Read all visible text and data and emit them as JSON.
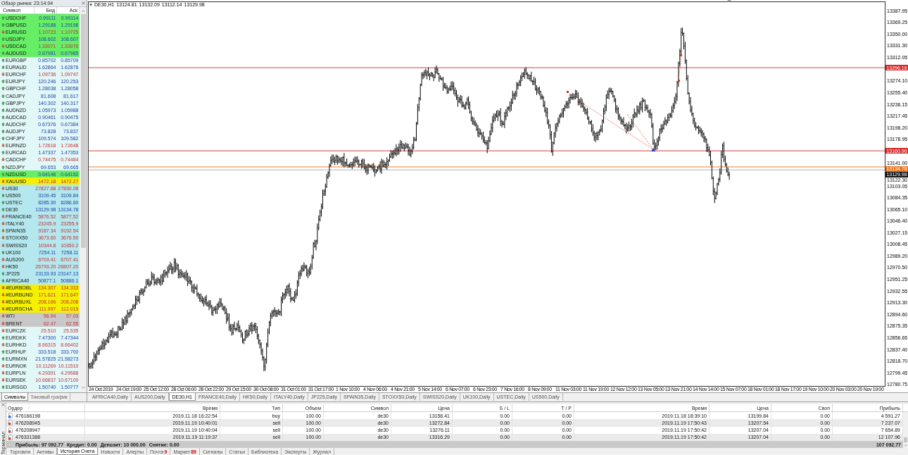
{
  "market_watch": {
    "title": "Обзор рынка: 23:14:04",
    "columns": [
      "Символ",
      "Бид",
      "Аск"
    ],
    "rows": [
      {
        "symbol": "USDCHF",
        "bid": "0.99111",
        "ask": "0.99114",
        "rising": true,
        "color": "#66ee66"
      },
      {
        "symbol": "GBPUSD",
        "bid": "1.29188",
        "ask": "1.29198",
        "rising": true,
        "color": "#66ee66"
      },
      {
        "symbol": "EURUSD",
        "bid": "1.10723",
        "ask": "1.10725",
        "rising": false,
        "color": "#66ee66"
      },
      {
        "symbol": "USDJPY",
        "bid": "108.602",
        "ask": "108.607",
        "rising": true,
        "color": "#66ee66"
      },
      {
        "symbol": "USDCAD",
        "bid": "1.33071",
        "ask": "1.33076",
        "rising": false,
        "color": "#66ee66"
      },
      {
        "symbol": "AUDUSD",
        "bid": "0.67981",
        "ask": "0.67985",
        "rising": true,
        "color": "#66ee66"
      },
      {
        "symbol": "EURGBP",
        "bid": "0.85702",
        "ask": "0.85709",
        "rising": true,
        "color": "#e2f7f7"
      },
      {
        "symbol": "EURAUD",
        "bid": "1.62864",
        "ask": "1.62876",
        "rising": true,
        "color": "#e2f7f7"
      },
      {
        "symbol": "EURCHF",
        "bid": "1.09736",
        "ask": "1.09747",
        "rising": false,
        "color": "#e2f7f7"
      },
      {
        "symbol": "EURJPY",
        "bid": "120.246",
        "ask": "120.253",
        "rising": true,
        "color": "#e2f7f7"
      },
      {
        "symbol": "GBPCHF",
        "bid": "1.28038",
        "ask": "1.28058",
        "rising": true,
        "color": "#e2f7f7"
      },
      {
        "symbol": "CADJPY",
        "bid": "81.608",
        "ask": "81.617",
        "rising": true,
        "color": "#e2f7f7"
      },
      {
        "symbol": "GBPJPY",
        "bid": "140.302",
        "ask": "140.317",
        "rising": true,
        "color": "#e2f7f7"
      },
      {
        "symbol": "AUDNZD",
        "bid": "1.05973",
        "ask": "1.05988",
        "rising": true,
        "color": "#e2f7f7"
      },
      {
        "symbol": "AUDCAD",
        "bid": "0.90461",
        "ask": "0.90475",
        "rising": true,
        "color": "#e2f7f7"
      },
      {
        "symbol": "AUDCHF",
        "bid": "0.67376",
        "ask": "0.67384",
        "rising": true,
        "color": "#e2f7f7"
      },
      {
        "symbol": "AUDJPY",
        "bid": "73.828",
        "ask": "73.837",
        "rising": true,
        "color": "#e2f7f7"
      },
      {
        "symbol": "CHFJPY",
        "bid": "109.574",
        "ask": "109.582",
        "rising": true,
        "color": "#e2f7f7"
      },
      {
        "symbol": "EURNZD",
        "bid": "1.72618",
        "ask": "1.72648",
        "rising": false,
        "color": "#e2f7f7"
      },
      {
        "symbol": "EURCAD",
        "bid": "1.47337",
        "ask": "1.47353",
        "rising": true,
        "color": "#e2f7f7"
      },
      {
        "symbol": "CADCHF",
        "bid": "0.74475",
        "ask": "0.74484",
        "rising": false,
        "color": "#e2f7f7"
      },
      {
        "symbol": "NZDJPY",
        "bid": "69.653",
        "ask": "69.665",
        "rising": true,
        "color": "#e2f7f7"
      },
      {
        "symbol": "NZDUSD",
        "bid": "0.64146",
        "ask": "0.64152",
        "rising": true,
        "color": "#66ee66"
      },
      {
        "symbol": "XAUUSD",
        "bid": "1472.18",
        "ask": "1472.27",
        "rising": false,
        "color": "#f4f000"
      },
      {
        "symbol": "US30",
        "bid": "27827.88",
        "ask": "27830.08",
        "rising": false,
        "color": "#b4e8ee"
      },
      {
        "symbol": "US500",
        "bid": "3109.45",
        "ask": "3109.84",
        "rising": true,
        "color": "#b4e8ee"
      },
      {
        "symbol": "USTEC",
        "bid": "8285.30",
        "ask": "8286.60",
        "rising": true,
        "color": "#b4e8ee"
      },
      {
        "symbol": "DE30",
        "bid": "13129.98",
        "ask": "13134.78",
        "rising": true,
        "color": "#b4e8ee"
      },
      {
        "symbol": "FRANCE40",
        "bid": "5876.52",
        "ask": "5877.52",
        "rising": false,
        "color": "#b4e8ee"
      },
      {
        "symbol": "ITALY40",
        "bid": "23245.9",
        "ask": "23255.9",
        "rising": false,
        "color": "#b4e8ee"
      },
      {
        "symbol": "SPAIN35",
        "bid": "9187.34",
        "ask": "9192.54",
        "rising": false,
        "color": "#b4e8ee"
      },
      {
        "symbol": "STOXX50",
        "bid": "3673.60",
        "ask": "3676.50",
        "rising": false,
        "color": "#b4e8ee"
      },
      {
        "symbol": "SWISS20",
        "bid": "10344.8",
        "ask": "10350.2",
        "rising": false,
        "color": "#b4e8ee"
      },
      {
        "symbol": "UK100",
        "bid": "7254.11",
        "ask": "7258.11",
        "rising": true,
        "color": "#b4e8ee"
      },
      {
        "symbol": "AUS200",
        "bid": "6703.41",
        "ask": "6707.41",
        "rising": false,
        "color": "#b4e8ee"
      },
      {
        "symbol": "HK50",
        "bid": "26793.20",
        "ask": "26807.20",
        "rising": false,
        "color": "#b4e8ee"
      },
      {
        "symbol": "JP225",
        "bid": "23133.93",
        "ask": "23147.13",
        "rising": true,
        "color": "#b4e8ee"
      },
      {
        "symbol": "AFRICA40",
        "bid": "50877.1",
        "ask": "50886.1",
        "rising": true,
        "color": "#b4e8ee"
      },
      {
        "symbol": "#EURBOBL",
        "bid": "134.307",
        "ask": "134.333",
        "rising": false,
        "color": "#f4f000"
      },
      {
        "symbol": "#EURBUND",
        "bid": "171.621",
        "ask": "171.647",
        "rising": false,
        "color": "#f4f000"
      },
      {
        "symbol": "#EURBUXL",
        "bid": "208.166",
        "ask": "208.208",
        "rising": false,
        "color": "#f4f000"
      },
      {
        "symbol": "#EURSCHA",
        "bid": "111.997",
        "ask": "112.015",
        "rising": false,
        "color": "#f4f000"
      },
      {
        "symbol": "WTI",
        "bid": "56.94",
        "ask": "57.03",
        "rising": false,
        "color": "#c8c8c8"
      },
      {
        "symbol": "BRENT",
        "bid": "62.47",
        "ask": "62.55",
        "rising": false,
        "color": "#c8c8c8"
      },
      {
        "symbol": "EURCZK",
        "bid": "25.510",
        "ask": "25.535",
        "rising": false,
        "color": "#e2f7f7"
      },
      {
        "symbol": "EURDKK",
        "bid": "7.47300",
        "ask": "7.47344",
        "rising": true,
        "color": "#e2f7f7"
      },
      {
        "symbol": "EURHKD",
        "bid": "8.66315",
        "ask": "8.66402",
        "rising": false,
        "color": "#e2f7f7"
      },
      {
        "symbol": "EURHUF",
        "bid": "333.518",
        "ask": "333.700",
        "rising": true,
        "color": "#e2f7f7"
      },
      {
        "symbol": "EURMXN",
        "bid": "21.57825",
        "ask": "21.58273",
        "rising": true,
        "color": "#e2f7f7"
      },
      {
        "symbol": "EURNOK",
        "bid": "10.11269",
        "ask": "10.11510",
        "rising": false,
        "color": "#e2f7f7"
      },
      {
        "symbol": "EURPLN",
        "bid": "4.29391",
        "ask": "4.29588",
        "rising": false,
        "color": "#e2f7f7"
      },
      {
        "symbol": "EURSEK",
        "bid": "10.66837",
        "ask": "10.67100",
        "rising": false,
        "color": "#e2f7f7"
      },
      {
        "symbol": "EURSGD",
        "bid": "1.50740",
        "ask": "1.50777",
        "rising": true,
        "color": "#e2f7f7"
      }
    ],
    "tabs": [
      {
        "label": "Символы",
        "selected": true
      },
      {
        "label": "Тиковый график",
        "selected": false
      }
    ]
  },
  "chart": {
    "symbol": "DE30,H1",
    "ohlc": [
      "13124.81",
      "13132.09",
      "13112.14",
      "13129.98"
    ],
    "price_labels": [
      "13387.95",
      "13369.25",
      "13350.00",
      "13331.30",
      "13312.05",
      "13274.10",
      "13255.40",
      "13236.15",
      "13217.45",
      "13198.20",
      "13178.95",
      "13141.00",
      "13122.30",
      "13103.05",
      "13084.35",
      "13065.10",
      "13046.40",
      "13027.15",
      "13008.45",
      "12989.20",
      "12970.50",
      "12951.25",
      "12932.55",
      "12913.30",
      "12894.60",
      "12875.35",
      "12856.65",
      "12837.40",
      "12818.70",
      "12799.45",
      "12780.75"
    ],
    "price_markers": [
      {
        "kind": "level",
        "price": "13296.16",
        "color": "#d42a2a"
      },
      {
        "kind": "level",
        "price": "13160.96",
        "color": "#d42a2a"
      },
      {
        "kind": "ask",
        "price": "13134.78",
        "color": "#e8731c"
      },
      {
        "kind": "bid",
        "price": "13129.98",
        "color": "#111111"
      }
    ],
    "time_labels": [
      "24 Oct 2019",
      "24 Oct 19:00",
      "25 Oct 12:00",
      "28 Oct 06:00",
      "28 Oct 22:00",
      "29 Oct 15:00",
      "30 Oct 08:00",
      "31 Oct 01:00",
      "31 Oct 17:00",
      "1 Nov 10:00",
      "4 Nov 06:00",
      "4 Nov 21:00",
      "5 Nov 14:00",
      "6 Nov 07:00",
      "6 Nov 23:00",
      "7 Nov 16:00",
      "8 Nov 09:00",
      "11 Nov 03:00",
      "11 Nov 19:00",
      "12 Nov 12:00",
      "13 Nov 05:00",
      "13 Nov 21:00",
      "14 Nov 14:00",
      "15 Nov 07:00",
      "18 Nov 01:00",
      "18 Nov 17:00",
      "19 Nov 10:00",
      "20 Nov 03:00",
      "20 Nov 19:00"
    ]
  },
  "chart_tabs": [
    {
      "label": "AFRICA40,Daily",
      "selected": false
    },
    {
      "label": "AUS200,Daily",
      "selected": false
    },
    {
      "label": "DE30,H1",
      "selected": true
    },
    {
      "label": "FRANCE40,Daily",
      "selected": false
    },
    {
      "label": "HK50,Daily",
      "selected": false
    },
    {
      "label": "ITALY40,Daily",
      "selected": false
    },
    {
      "label": "JP225,Daily",
      "selected": false
    },
    {
      "label": "SPAIN35,Daily",
      "selected": false
    },
    {
      "label": "STOXX50,Daily",
      "selected": false
    },
    {
      "label": "SWISS20,Daily",
      "selected": false
    },
    {
      "label": "UK100,Daily",
      "selected": false
    },
    {
      "label": "USTEC,Daily",
      "selected": false
    },
    {
      "label": "US500,Daily",
      "selected": false
    }
  ],
  "terminal": {
    "side_label": "Терминал",
    "columns": [
      "Ордер",
      "Время",
      "Тип",
      "Объем",
      "Символ",
      "Цена",
      "S / L",
      "T / P",
      "Время",
      "Цена",
      "Своп",
      "Прибыль"
    ],
    "rows": [
      {
        "kind": "buy",
        "cells": [
          "476166198",
          "2019.11.18 16:22:54",
          "buy",
          "100.00",
          "de30",
          "13158.41",
          "0.00",
          "0.00",
          "2019.11.18 18:39:10",
          "13199.84",
          "0.00",
          "4 591.27"
        ]
      },
      {
        "kind": "sell",
        "cells": [
          "476208945",
          "2019.11.19 10:40:01",
          "sell",
          "100.00",
          "de30",
          "13272.84",
          "0.00",
          "0.00",
          "2019.11.19 17:50:43",
          "13207.54",
          "0.00",
          "7 237.07"
        ]
      },
      {
        "kind": "sell",
        "cells": [
          "476208947",
          "2019.11.19 10:40:04",
          "sell",
          "100.00",
          "de30",
          "13276.11",
          "0.00",
          "0.00",
          "2019.11.19 17:50:42",
          "13207.04",
          "0.00",
          "7 654.89"
        ]
      },
      {
        "kind": "sell",
        "cells": [
          "476331388",
          "2019.11.19 11:19:37",
          "sell",
          "100.00",
          "de30",
          "13316.29",
          "0.00",
          "0.00",
          "2019.11.19 17:50:42",
          "13207.04",
          "0.00",
          "12 107.96"
        ]
      }
    ],
    "summary": [
      "Прибыль: 97 092.77",
      "Кредит: 0.00",
      "Депозит: 10 000.00",
      "Снятие: 0.00"
    ],
    "total": "107 092.77",
    "tabs": [
      {
        "label": "Торговля",
        "selected": false
      },
      {
        "label": "Активы",
        "selected": false
      },
      {
        "label": "История Счета",
        "selected": true
      },
      {
        "label": "Новости",
        "selected": false
      },
      {
        "label": "Алерты",
        "selected": false
      },
      {
        "label": "Почта",
        "badge": "9",
        "selected": false
      },
      {
        "label": "Маркет",
        "badge": "89",
        "selected": false
      },
      {
        "label": "Сигналы",
        "selected": false
      },
      {
        "label": "Статьи",
        "selected": false
      },
      {
        "label": "Библиотека",
        "selected": false
      },
      {
        "label": "Эксперты",
        "selected": false
      },
      {
        "label": "Журнал",
        "selected": false
      }
    ]
  }
}
